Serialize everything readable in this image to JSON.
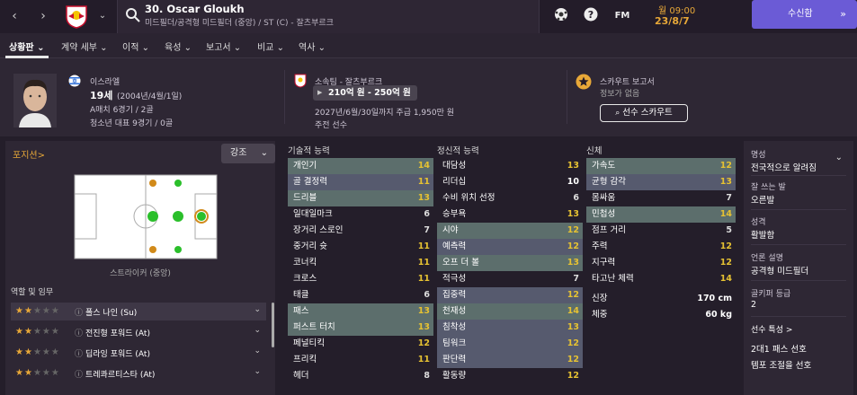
{
  "topbar": {
    "player_title": "30. Oscar Gloukh",
    "player_subtitle": "미드필더/공격형 미드필더 (중앙) / ST (C) - 잘츠부르크",
    "fm_label": "FM",
    "date_day": "월 09:00",
    "date_date": "23/8/7",
    "continue_label": "수신함"
  },
  "tabs": [
    "상황판",
    "계약 세부",
    "이적",
    "육성",
    "보고서",
    "비교",
    "역사"
  ],
  "profile": {
    "nation": "이스라엘",
    "age": "19세",
    "birth": "(2004년/4월/1일)",
    "caps": "A매치 6경기 / 2골",
    "youth_caps": "청소년 대표 9경기 / 0골",
    "club": "소속팀 - 잘츠부르크",
    "wage_range": "210억 원 - 250억 원",
    "contract": "2027년/6월/30일까지 주급 1,950만 원",
    "squad_status": "주전 선수",
    "scout_title": "스카우트 보고서",
    "scout_sub": "정보가 없음",
    "scout_button": "선수 스카우트"
  },
  "left": {
    "position_label": "포지션",
    "emphasis_label": "강조",
    "position_caption": "스트라이커 (중앙)",
    "roles_label": "역할 및 임무",
    "roles": [
      {
        "name": "폴스 나인 (Su)",
        "stars": 2
      },
      {
        "name": "전진형 포워드 (At)",
        "stars": 2
      },
      {
        "name": "딥라잉 포워드 (At)",
        "stars": 2
      },
      {
        "name": "트레콰르티스타 (At)",
        "stars": 2
      }
    ]
  },
  "technical": {
    "title": "기술적 능력",
    "items": [
      {
        "label": "개인기",
        "value": "14",
        "hl": true
      },
      {
        "label": "골 결정력",
        "value": "11",
        "hl2": true
      },
      {
        "label": "드리블",
        "value": "13",
        "hl": true
      },
      {
        "label": "일대일마크",
        "value": "6"
      },
      {
        "label": "장거리 스로인",
        "value": "7"
      },
      {
        "label": "중거리 슛",
        "value": "11"
      },
      {
        "label": "코너킥",
        "value": "11"
      },
      {
        "label": "크로스",
        "value": "11"
      },
      {
        "label": "태클",
        "value": "6"
      },
      {
        "label": "패스",
        "value": "13",
        "hl": true
      },
      {
        "label": "퍼스트 터치",
        "value": "13",
        "hl": true
      },
      {
        "label": "페널티킥",
        "value": "12"
      },
      {
        "label": "프리킥",
        "value": "11"
      },
      {
        "label": "헤더",
        "value": "8"
      }
    ]
  },
  "mental": {
    "title": "정신적 능력",
    "items": [
      {
        "label": "대담성",
        "value": "13"
      },
      {
        "label": "리더십",
        "value": "10"
      },
      {
        "label": "수비 위치 선정",
        "value": "6"
      },
      {
        "label": "승부욕",
        "value": "13"
      },
      {
        "label": "시야",
        "value": "12",
        "hl": true
      },
      {
        "label": "예측력",
        "value": "12",
        "hl2": true
      },
      {
        "label": "오프 더 볼",
        "value": "13",
        "hl": true
      },
      {
        "label": "적극성",
        "value": "7"
      },
      {
        "label": "집중력",
        "value": "12",
        "hl2": true
      },
      {
        "label": "천재성",
        "value": "14",
        "hl": true
      },
      {
        "label": "침착성",
        "value": "13",
        "hl2": true
      },
      {
        "label": "팀워크",
        "value": "12",
        "hl2": true
      },
      {
        "label": "판단력",
        "value": "12",
        "hl2": true
      },
      {
        "label": "활동량",
        "value": "12"
      }
    ]
  },
  "physical": {
    "title": "신체",
    "items": [
      {
        "label": "가속도",
        "value": "12",
        "hl": true
      },
      {
        "label": "균형 감각",
        "value": "13",
        "hl2": true
      },
      {
        "label": "몸싸움",
        "value": "7"
      },
      {
        "label": "민첩성",
        "value": "14",
        "hl": true
      },
      {
        "label": "점프 거리",
        "value": "5"
      },
      {
        "label": "주력",
        "value": "12"
      },
      {
        "label": "지구력",
        "value": "12"
      },
      {
        "label": "타고난 체력",
        "value": "14"
      }
    ],
    "height_label": "신장",
    "height": "170 cm",
    "weight_label": "체중",
    "weight": "60 kg"
  },
  "right": {
    "fame_label": "명성",
    "fame": "전국적으로 알려짐",
    "foot_label": "잘 쓰는 발",
    "foot": "오른발",
    "personality_label": "성격",
    "personality": "활발함",
    "media_label": "언론 설명",
    "media": "공격형 미드필더",
    "gk_label": "골키퍼 등급",
    "gk": "2",
    "traits_label": "선수 특성",
    "traits": [
      "2대1 패스 선호",
      "템포 조절을 선호"
    ]
  }
}
